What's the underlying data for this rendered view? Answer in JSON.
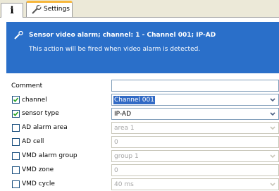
{
  "tabs": {
    "info_icon": "i",
    "settings_label": "Settings"
  },
  "banner": {
    "title": "Sensor video alarm; channel: 1 - Channel 001; IP-AD",
    "description": "This action will be fired when video alarm is detected."
  },
  "form": {
    "comment": {
      "label": "Comment",
      "value": ""
    },
    "rows": [
      {
        "label": "channel",
        "checked": true,
        "value": "Channel 001",
        "enabled": true,
        "kind": "select"
      },
      {
        "label": "sensor type",
        "checked": true,
        "value": "IP-AD",
        "enabled": true,
        "kind": "select"
      },
      {
        "label": "AD alarm area",
        "checked": false,
        "value": "area 1",
        "enabled": false,
        "kind": "select"
      },
      {
        "label": "AD cell",
        "checked": false,
        "value": "0",
        "enabled": false,
        "kind": "text"
      },
      {
        "label": "VMD alarm group",
        "checked": false,
        "value": "group 1",
        "enabled": false,
        "kind": "select"
      },
      {
        "label": "VMD zone",
        "checked": false,
        "value": "0",
        "enabled": false,
        "kind": "text"
      },
      {
        "label": "VMD cycle",
        "checked": false,
        "value": "40 ms",
        "enabled": false,
        "kind": "select"
      }
    ]
  },
  "colors": {
    "banner_bg": "#2a6fc9",
    "tab_accent": "#f7b73c",
    "selection": "#316ac5"
  }
}
